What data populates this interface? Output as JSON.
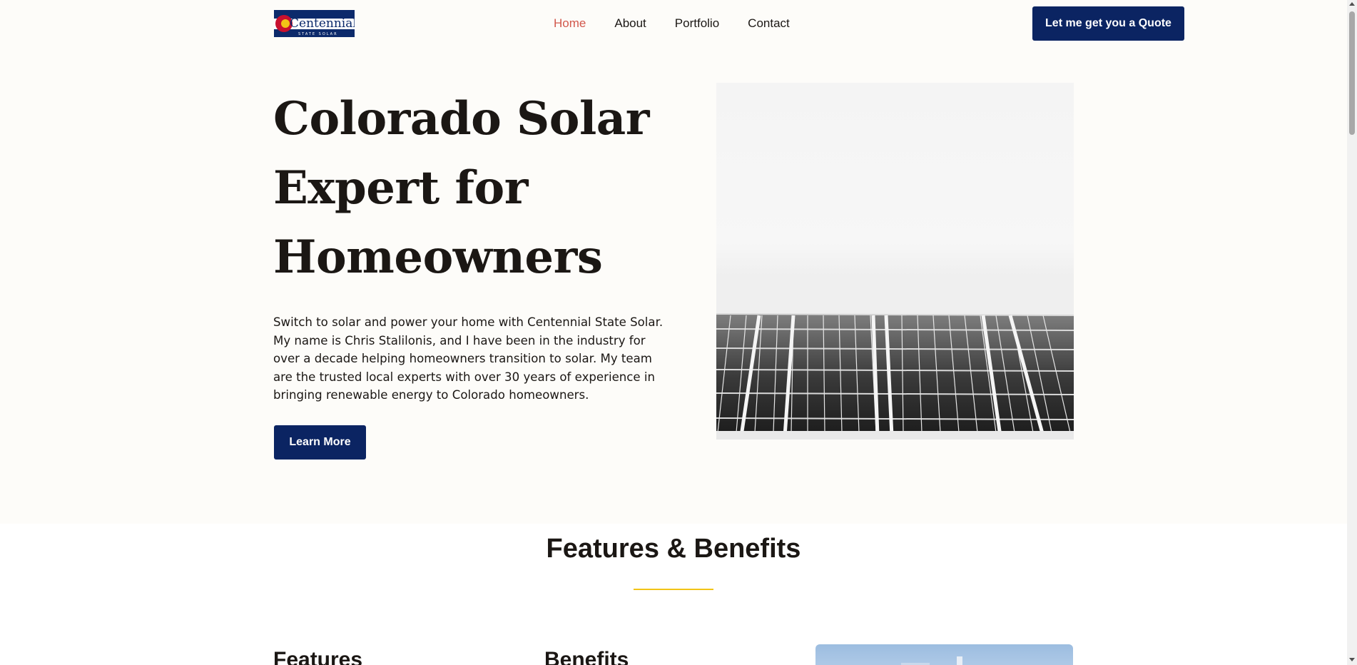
{
  "logo": {
    "text": "Centennial",
    "subtext": "STATE SOLAR"
  },
  "nav": {
    "items": [
      {
        "label": "Home",
        "active": true
      },
      {
        "label": "About",
        "active": false
      },
      {
        "label": "Portfolio",
        "active": false
      },
      {
        "label": "Contact",
        "active": false
      }
    ],
    "quote_label": "Let me get you a Quote"
  },
  "hero": {
    "title_lines": [
      "Colorado Solar",
      "Expert for",
      "Homeowners"
    ],
    "description": "Switch to solar and power your home with Centennial State Solar. My name is Chris Stalilonis, and I have been in the industry for over a decade helping homeowners transition to solar.  My team are the trusted local experts with over 30 years of experience in bringing renewable energy to Colorado homeowners.",
    "learn_more_label": "Learn More"
  },
  "features": {
    "title": "Features & Benefits",
    "col1_heading": "Features",
    "col2_heading": "Benefits"
  },
  "colors": {
    "primary": "#0b2462",
    "accent_active": "#d2584c",
    "rule": "#f2c416",
    "background": "#fdfcf9"
  }
}
